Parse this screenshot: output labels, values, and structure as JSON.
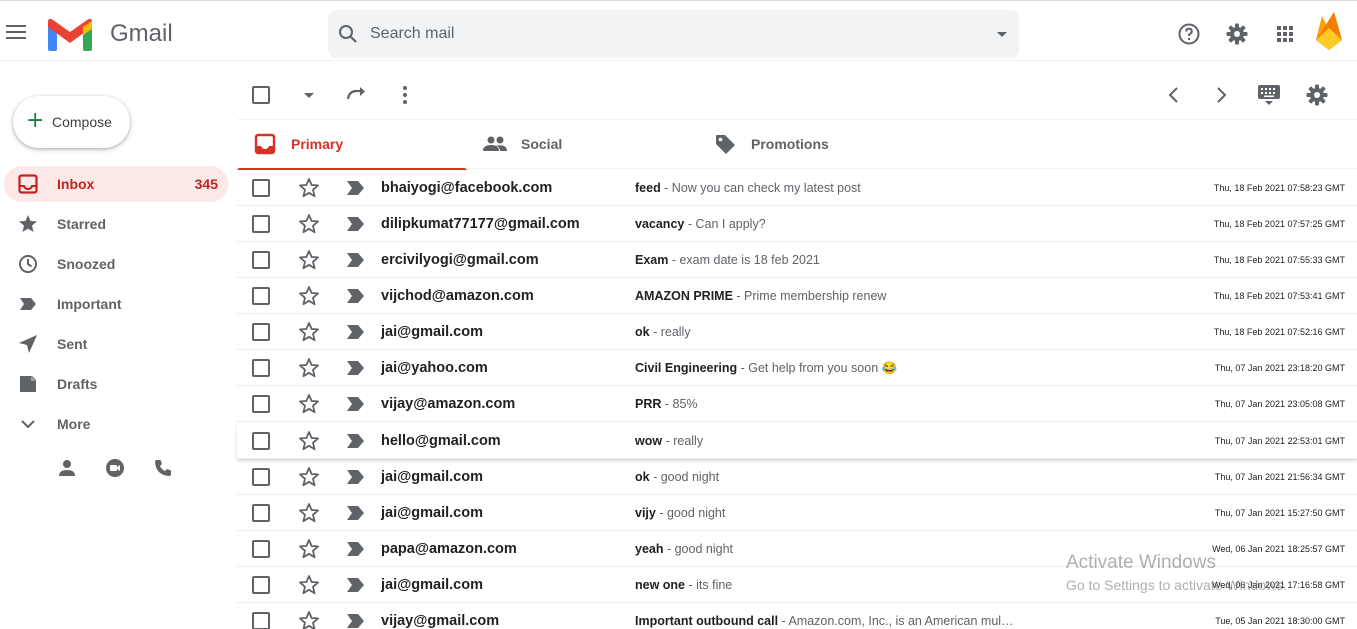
{
  "header": {
    "brand": "Gmail",
    "search_placeholder": "Search mail",
    "icons": [
      "menu-icon",
      "gmail-logo",
      "search-icon",
      "search-options-icon",
      "help-icon",
      "settings-icon",
      "apps-icon",
      "account-avatar"
    ]
  },
  "compose": {
    "label": "Compose"
  },
  "sidebar": {
    "items": [
      {
        "label": "Inbox",
        "count": "345",
        "icon": "inbox-icon",
        "active": true
      },
      {
        "label": "Starred",
        "icon": "star-icon"
      },
      {
        "label": "Snoozed",
        "icon": "clock-icon"
      },
      {
        "label": "Important",
        "icon": "important-icon"
      },
      {
        "label": "Sent",
        "icon": "send-icon"
      },
      {
        "label": "Drafts",
        "icon": "drafts-icon"
      },
      {
        "label": "More",
        "icon": "chevron-down-icon"
      }
    ],
    "footer_icons": [
      "person-icon",
      "meet-icon",
      "phone-icon"
    ]
  },
  "toolbar": {
    "icons": [
      "select-all-checkbox",
      "select-dropdown-icon",
      "refresh-icon",
      "more-vert-icon",
      "chevron-left-icon",
      "chevron-right-icon",
      "keyboard-icon",
      "settings-icon"
    ]
  },
  "tabs": [
    {
      "label": "Primary",
      "icon": "inbox-tab-icon",
      "active": true
    },
    {
      "label": "Social",
      "icon": "people-icon"
    },
    {
      "label": "Promotions",
      "icon": "tag-icon"
    }
  ],
  "emails": [
    {
      "sender": "bhaiyogi@facebook.com",
      "subject": "feed",
      "snippet": " - Now you can check my latest post",
      "date": "Thu, 18 Feb 2021 07:58:23 GMT"
    },
    {
      "sender": "dilipkumat77177@gmail.com",
      "subject": "vacancy",
      "snippet": " - Can I apply?",
      "date": "Thu, 18 Feb 2021 07:57:25 GMT"
    },
    {
      "sender": "ercivilyogi@gmail.com",
      "subject": "Exam",
      "snippet": " - exam date is 18 feb 2021",
      "date": "Thu, 18 Feb 2021 07:55:33 GMT"
    },
    {
      "sender": "vijchod@amazon.com",
      "subject": "AMAZON PRIME",
      "snippet": " - Prime membership renew",
      "date": "Thu, 18 Feb 2021 07:53:41 GMT"
    },
    {
      "sender": "jai@gmail.com",
      "subject": "ok",
      "snippet": " - really",
      "date": "Thu, 18 Feb 2021 07:52:16 GMT"
    },
    {
      "sender": "jai@yahoo.com",
      "subject": "Civil Engineering",
      "snippet": " - Get help from you soon 😂",
      "date": "Thu, 07 Jan 2021 23:18:20 GMT"
    },
    {
      "sender": "vijay@amazon.com",
      "subject": "PRR",
      "snippet": " - 85%",
      "date": "Thu, 07 Jan 2021 23:05:08 GMT"
    },
    {
      "sender": "hello@gmail.com",
      "subject": "wow",
      "snippet": " - really",
      "date": "Thu, 07 Jan 2021 22:53:01 GMT"
    },
    {
      "sender": "jai@gmail.com",
      "subject": "ok",
      "snippet": " - good night",
      "date": "Thu, 07 Jan 2021 21:56:34 GMT"
    },
    {
      "sender": "jai@gmail.com",
      "subject": "vijy",
      "snippet": " - good night",
      "date": "Thu, 07 Jan 2021 15:27:50 GMT"
    },
    {
      "sender": "papa@amazon.com",
      "subject": "yeah",
      "snippet": " - good night",
      "date": "Wed, 06 Jan 2021 18:25:57 GMT"
    },
    {
      "sender": "jai@gmail.com",
      "subject": "new one",
      "snippet": " - its fine",
      "date": "Wed, 06 Jan 2021 17:16:58 GMT"
    },
    {
      "sender": "vijay@gmail.com",
      "subject": "Important outbound call",
      "snippet": " - Amazon.com, Inc., is an American mul…",
      "date": "Tue, 05 Jan 2021 18:30:00 GMT"
    }
  ],
  "watermark": {
    "line1": "Activate Windows",
    "line2": "Go to Settings to activate Windows."
  },
  "colors": {
    "accent_red": "#d93025",
    "active_bg": "#fce8e6",
    "search_bg": "#f1f3f4",
    "icon_gray": "#5f6368"
  }
}
